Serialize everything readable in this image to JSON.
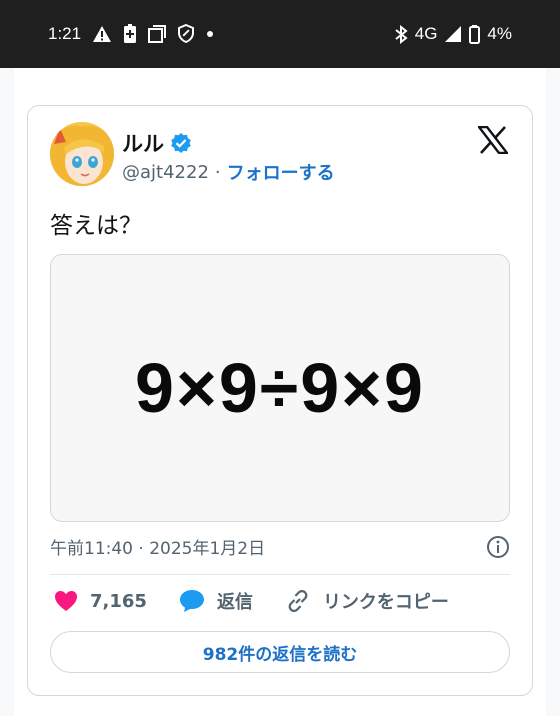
{
  "status_bar": {
    "time": "1:21",
    "network": "4G",
    "battery": "4%",
    "left_icons": [
      "warning-icon",
      "battery-saver-icon",
      "screen-icon",
      "shield-icon",
      "dot-icon"
    ],
    "right_icons": [
      "bluetooth-icon",
      "signal-icon",
      "battery-icon"
    ]
  },
  "tweet": {
    "author_name": "ルル",
    "handle": "@ajt4222",
    "separator": "·",
    "follow_label": "フォローする",
    "text": "答えは？",
    "media_text": "9×9÷9×9",
    "timestamp": "午前11:40 · 2025年1月2日",
    "likes": "7,165",
    "reply_label": "返信",
    "copy_link_label": "リンクをコピー",
    "read_replies_label": "982件の返信を読む"
  },
  "colors": {
    "accent": "#1d72c8",
    "verified": "#1d9bf0",
    "like": "#f91880",
    "text_secondary": "#536471",
    "status_bar_bg": "#1f1f1f"
  }
}
